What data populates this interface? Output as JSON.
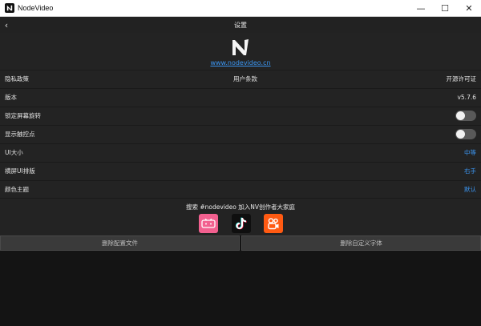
{
  "window": {
    "title": "NodeVideo",
    "controls": {
      "minimize": "—",
      "maximize": "☐",
      "close": "✕"
    }
  },
  "header": {
    "back": "‹",
    "title": "设置"
  },
  "logo": {
    "url_text": "www.nodevideo.cn"
  },
  "links": {
    "privacy": "隐私政策",
    "terms": "用户条款",
    "opensource": "开源许可证"
  },
  "rows": {
    "version": {
      "label": "版本",
      "value": "v5.7.6"
    },
    "lock_rotation": {
      "label": "锁定屏幕旋转",
      "on": false
    },
    "show_touch": {
      "label": "显示触控点",
      "on": false
    },
    "ui_size": {
      "label": "UI大小",
      "value": "中等"
    },
    "landscape_layout": {
      "label": "横屏UI排版",
      "value": "右手"
    },
    "color_theme": {
      "label": "颜色主题",
      "value": "默认"
    }
  },
  "community": {
    "text": "搜索 #nodevideo 加入NV创作者大家庭",
    "icons": [
      "bilibili-icon",
      "tiktok-icon",
      "kuaishou-icon"
    ]
  },
  "buttons": {
    "delete_config": "删除配置文件",
    "delete_fonts": "删除自定义字体"
  },
  "colors": {
    "accent": "#3b95f0",
    "background": "#232323",
    "bilibili": "#f2608f",
    "kuaishou": "#ff5a12"
  }
}
